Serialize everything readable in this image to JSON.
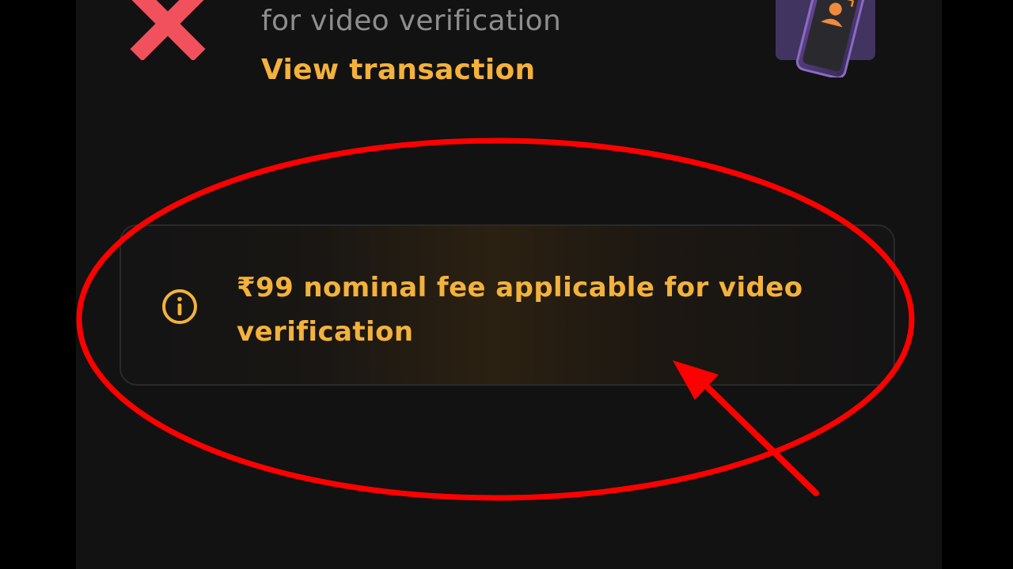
{
  "header": {
    "status_icon": "close-x-icon",
    "subtitle": "for video verification",
    "view_transaction_label": "View transaction",
    "illustration": "phone-video-verification-icon"
  },
  "fee_notice": {
    "icon": "info-icon",
    "text": "₹99 nominal fee applicable for video verification"
  },
  "annotation": {
    "shapes": [
      "red-ellipse",
      "red-arrow"
    ]
  },
  "colors": {
    "background": "#121212",
    "accent": "#f3b23c",
    "error": "#f0515d",
    "annotation": "#ff0000",
    "muted_text": "#8e8e8e"
  }
}
